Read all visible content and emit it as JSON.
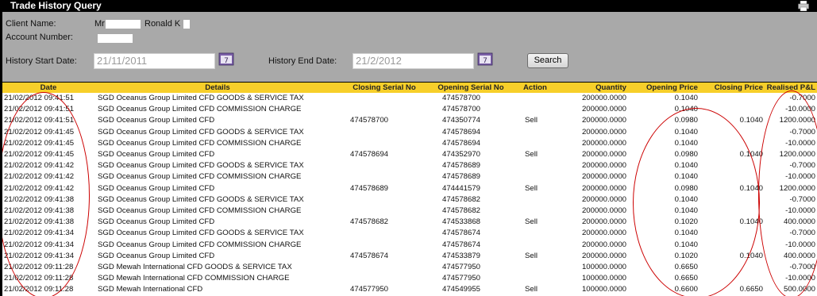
{
  "window": {
    "title": "Trade History Query",
    "print_icon": "printer-icon"
  },
  "client": {
    "name_label": "Client Name:",
    "name_prefix": "Mr",
    "name_visible": "Ronald K",
    "account_label": "Account Number:"
  },
  "history": {
    "start_label": "History Start Date:",
    "start_value": "21/11/2011",
    "end_label": "History End Date:",
    "end_value": "21/2/2012",
    "calendar_icon": "calendar-icon",
    "search_label": "Search"
  },
  "table": {
    "headers": [
      "Date",
      "Details",
      "Closing Serial No",
      "Opening Serial No",
      "Action",
      "Quantity",
      "Opening Price",
      "Closing Price",
      "Realised P&L"
    ],
    "rows": [
      [
        "21/02/2012 09:41:51",
        "SGD Oceanus Group Limited CFD GOODS & SERVICE TAX",
        "",
        "474578700",
        "",
        "200000.0000",
        "0.1040",
        "",
        "-0.7000"
      ],
      [
        "21/02/2012 09:41:51",
        "SGD Oceanus Group Limited CFD COMMISSION CHARGE",
        "",
        "474578700",
        "",
        "200000.0000",
        "0.1040",
        "",
        "-10.0000"
      ],
      [
        "21/02/2012 09:41:51",
        "SGD Oceanus Group Limited CFD",
        "474578700",
        "474350774",
        "Sell",
        "200000.0000",
        "0.0980",
        "0.1040",
        "1200.0000"
      ],
      [
        "21/02/2012 09:41:45",
        "SGD Oceanus Group Limited CFD GOODS & SERVICE TAX",
        "",
        "474578694",
        "",
        "200000.0000",
        "0.1040",
        "",
        "-0.7000"
      ],
      [
        "21/02/2012 09:41:45",
        "SGD Oceanus Group Limited CFD COMMISSION CHARGE",
        "",
        "474578694",
        "",
        "200000.0000",
        "0.1040",
        "",
        "-10.0000"
      ],
      [
        "21/02/2012 09:41:45",
        "SGD Oceanus Group Limited CFD",
        "474578694",
        "474352970",
        "Sell",
        "200000.0000",
        "0.0980",
        "0.1040",
        "1200.0000"
      ],
      [
        "21/02/2012 09:41:42",
        "SGD Oceanus Group Limited CFD GOODS & SERVICE TAX",
        "",
        "474578689",
        "",
        "200000.0000",
        "0.1040",
        "",
        "-0.7000"
      ],
      [
        "21/02/2012 09:41:42",
        "SGD Oceanus Group Limited CFD COMMISSION CHARGE",
        "",
        "474578689",
        "",
        "200000.0000",
        "0.1040",
        "",
        "-10.0000"
      ],
      [
        "21/02/2012 09:41:42",
        "SGD Oceanus Group Limited CFD",
        "474578689",
        "474441579",
        "Sell",
        "200000.0000",
        "0.0980",
        "0.1040",
        "1200.0000"
      ],
      [
        "21/02/2012 09:41:38",
        "SGD Oceanus Group Limited CFD GOODS & SERVICE TAX",
        "",
        "474578682",
        "",
        "200000.0000",
        "0.1040",
        "",
        "-0.7000"
      ],
      [
        "21/02/2012 09:41:38",
        "SGD Oceanus Group Limited CFD COMMISSION CHARGE",
        "",
        "474578682",
        "",
        "200000.0000",
        "0.1040",
        "",
        "-10.0000"
      ],
      [
        "21/02/2012 09:41:38",
        "SGD Oceanus Group Limited CFD",
        "474578682",
        "474533868",
        "Sell",
        "200000.0000",
        "0.1020",
        "0.1040",
        "400.0000"
      ],
      [
        "21/02/2012 09:41:34",
        "SGD Oceanus Group Limited CFD GOODS & SERVICE TAX",
        "",
        "474578674",
        "",
        "200000.0000",
        "0.1040",
        "",
        "-0.7000"
      ],
      [
        "21/02/2012 09:41:34",
        "SGD Oceanus Group Limited CFD COMMISSION CHARGE",
        "",
        "474578674",
        "",
        "200000.0000",
        "0.1040",
        "",
        "-10.0000"
      ],
      [
        "21/02/2012 09:41:34",
        "SGD Oceanus Group Limited CFD",
        "474578674",
        "474533879",
        "Sell",
        "200000.0000",
        "0.1020",
        "0.1040",
        "400.0000"
      ],
      [
        "21/02/2012 09:11:28",
        "SGD Mewah International CFD GOODS & SERVICE TAX",
        "",
        "474577950",
        "",
        "100000.0000",
        "0.6650",
        "",
        "-0.7000"
      ],
      [
        "21/02/2012 09:11:28",
        "SGD Mewah International CFD COMMISSION CHARGE",
        "",
        "474577950",
        "",
        "100000.0000",
        "0.6650",
        "",
        "-10.0000"
      ],
      [
        "21/02/2012 09:11:28",
        "SGD Mewah International CFD",
        "474577950",
        "474549955",
        "Sell",
        "100000.0000",
        "0.6600",
        "0.6650",
        "500.0000"
      ]
    ]
  },
  "colors": {
    "header_bg": "#f7cf2a",
    "panel_bg": "#a9a9a9",
    "annotation": "#c00000"
  }
}
